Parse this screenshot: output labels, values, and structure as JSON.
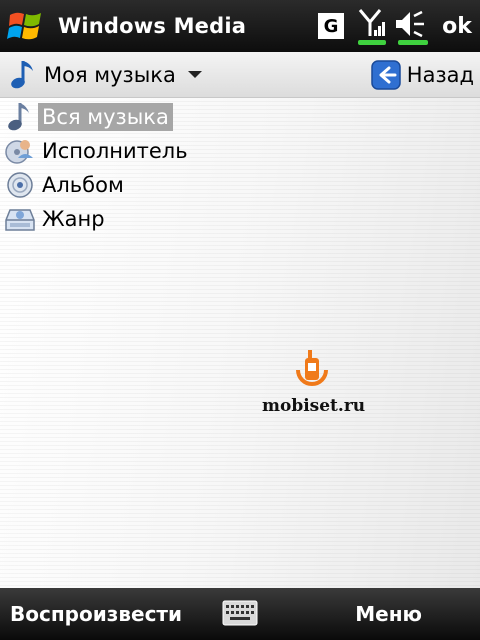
{
  "titlebar": {
    "app_title": "Windows Media",
    "network_badge": "G",
    "ok_label": "ok",
    "icons": [
      "windows-flag-icon",
      "signal-strength-icon",
      "volume-icon"
    ]
  },
  "navbar": {
    "title": "Моя музыка",
    "back_label": "Назад",
    "icons": [
      "music-note-icon",
      "dropdown-caret-icon",
      "back-arrow-icon"
    ]
  },
  "list": {
    "items": [
      {
        "label": "Вся музыка",
        "icon": "music-note-icon",
        "selected": true
      },
      {
        "label": "Исполнитель",
        "icon": "artist-icon",
        "selected": false
      },
      {
        "label": "Альбом",
        "icon": "album-disc-icon",
        "selected": false
      },
      {
        "label": "Жанр",
        "icon": "genre-icon",
        "selected": false
      }
    ]
  },
  "watermark": {
    "text": "mobiset.ru"
  },
  "softbar": {
    "left_label": "Воспроизвести",
    "right_label": "Меню",
    "center_icon": "keyboard-icon"
  },
  "colors": {
    "bar_dark": "#111111",
    "selection": "#a6a6a6",
    "back_blue": "#2f6fd1",
    "watermark_orange": "#f07a1a"
  }
}
